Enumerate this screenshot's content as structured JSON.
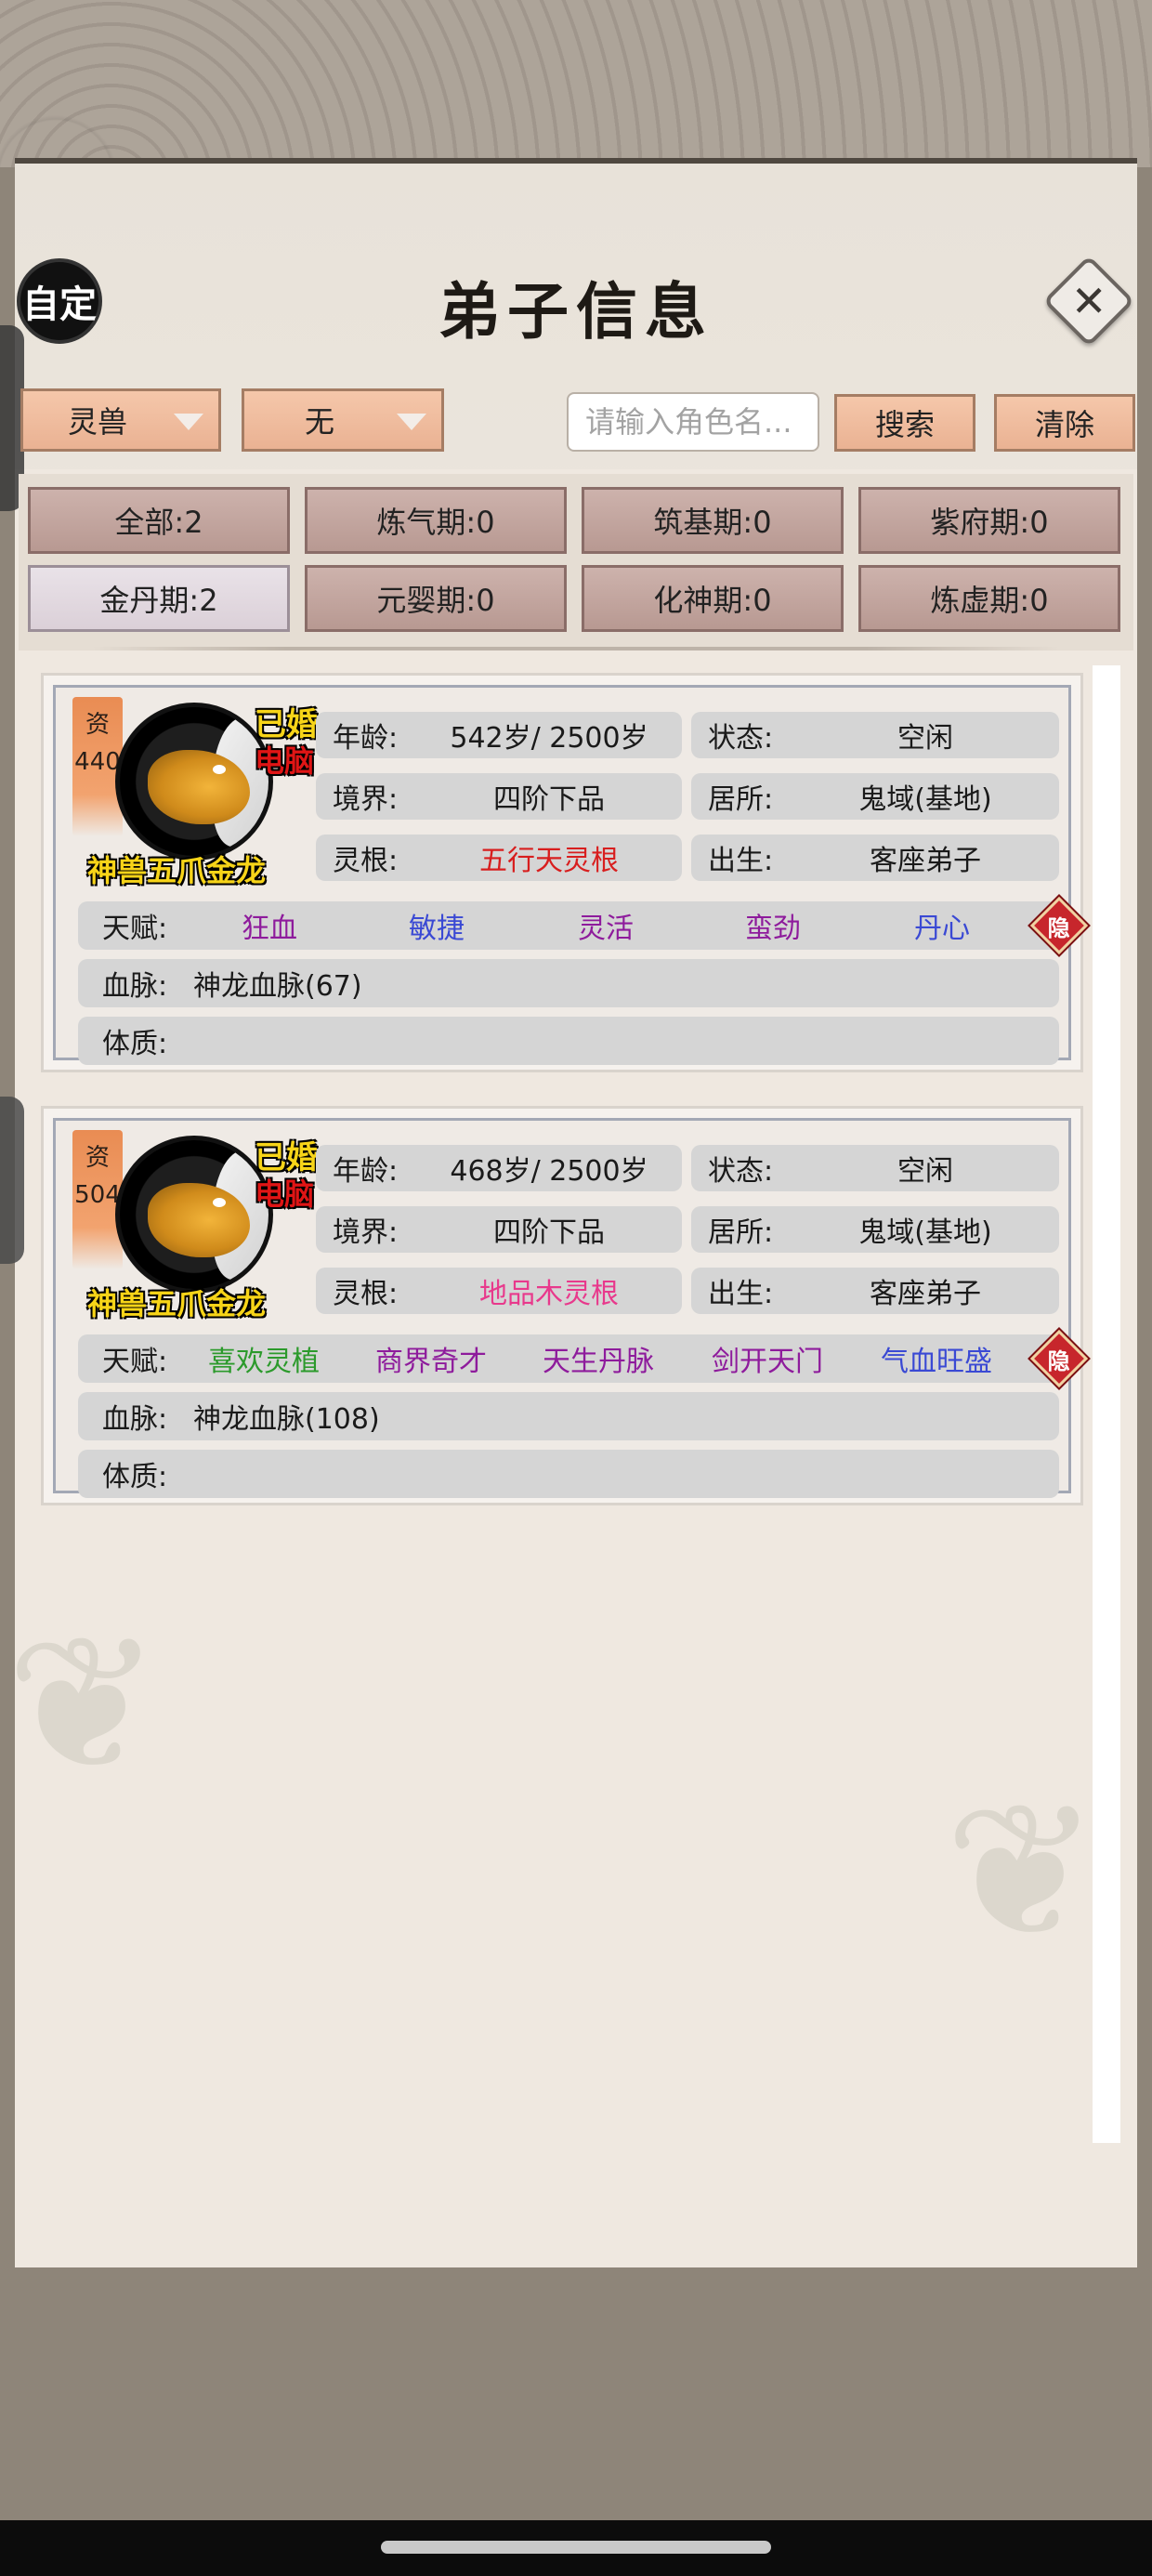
{
  "header": {
    "custom_label": "自定",
    "title": "弟子信息",
    "close_icon": "close-icon"
  },
  "filters": {
    "type_dropdown": "灵兽",
    "sub_dropdown": "无",
    "search_placeholder": "请输入角色名...",
    "search_label": "搜索",
    "clear_label": "清除"
  },
  "levels": [
    {
      "label": "全部:2",
      "active": false
    },
    {
      "label": "炼气期:0",
      "active": false
    },
    {
      "label": "筑基期:0",
      "active": false
    },
    {
      "label": "紫府期:0",
      "active": false
    },
    {
      "label": "金丹期:2",
      "active": true
    },
    {
      "label": "元婴期:0",
      "active": false
    },
    {
      "label": "化神期:0",
      "active": false
    },
    {
      "label": "炼虚期:0",
      "active": false
    }
  ],
  "labels": {
    "age": "年龄:",
    "status": "状态:",
    "realm": "境界:",
    "residence": "居所:",
    "root": "灵根:",
    "origin": "出生:",
    "talent": "天赋:",
    "bloodline": "血脉:",
    "physique": "体质:",
    "hide": "隐"
  },
  "disciples": [
    {
      "rank_char": "资",
      "rank_value": "440",
      "married": "已婚",
      "controller": "电脑",
      "name": "神兽五爪金龙",
      "age": "542岁/ 2500岁",
      "status": "空闲",
      "realm": "四阶下品",
      "residence": "鬼域(基地)",
      "root": "五行天灵根",
      "origin": "客座弟子",
      "talents": [
        {
          "text": "狂血",
          "color": "#8e1b9c"
        },
        {
          "text": "敏捷",
          "color": "#3a49d4"
        },
        {
          "text": "灵活",
          "color": "#8e1b9c"
        },
        {
          "text": "蛮劲",
          "color": "#8e1b9c"
        },
        {
          "text": "丹心",
          "color": "#3a49d4"
        }
      ],
      "bloodline": "神龙血脉(67)",
      "physique": ""
    },
    {
      "rank_char": "资",
      "rank_value": "504",
      "married": "已婚",
      "controller": "电脑",
      "name": "神兽五爪金龙",
      "age": "468岁/ 2500岁",
      "status": "空闲",
      "realm": "四阶下品",
      "residence": "鬼域(基地)",
      "root": "地品木灵根",
      "origin": "客座弟子",
      "talents": [
        {
          "text": "喜欢灵植",
          "color": "#2c9a2c"
        },
        {
          "text": "商界奇才",
          "color": "#8e1b9c"
        },
        {
          "text": "天生丹脉",
          "color": "#8e1b9c"
        },
        {
          "text": "剑开天门",
          "color": "#8e1b9c"
        },
        {
          "text": "气血旺盛",
          "color": "#3a49d4"
        }
      ],
      "bloodline": "神龙血脉(108)",
      "physique": ""
    }
  ]
}
